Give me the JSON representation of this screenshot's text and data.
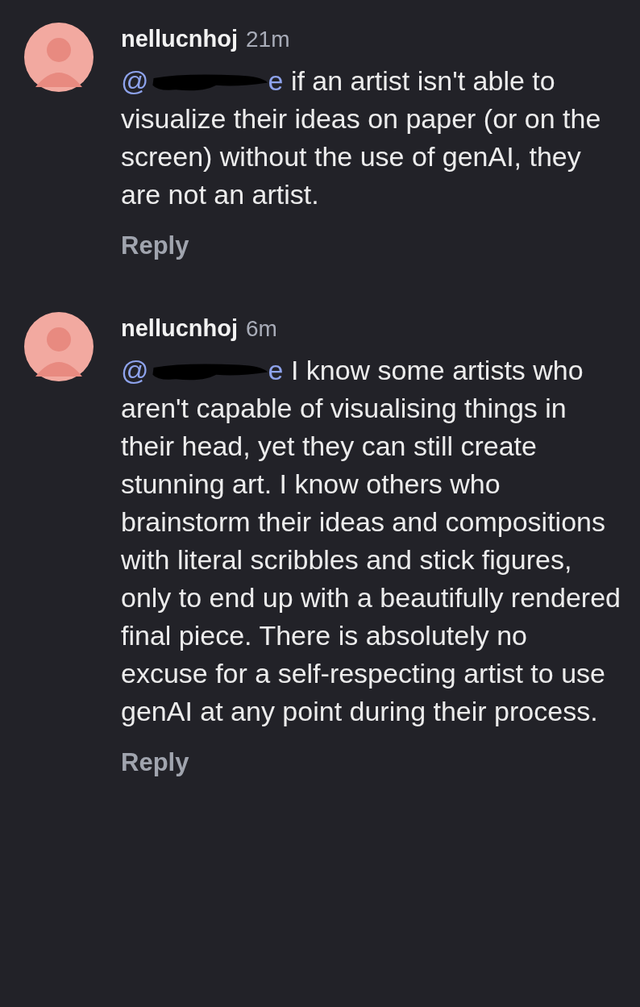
{
  "comments": [
    {
      "author": "nellucnhoj",
      "time": "21m",
      "mention_start": "@",
      "mention_end": "e",
      "text": "if an artist isn't able to visualize their ideas on paper (or on the screen) without the use of genAI, they are not an artist.",
      "reply": "Reply"
    },
    {
      "author": "nellucnhoj",
      "time": "6m",
      "mention_start": "@",
      "mention_end": "e",
      "text": "I know some artists who aren't capable of visualising things in their head, yet they can still create stunning art. I know others who brainstorm their ideas and compositions with literal scribbles and stick figures, only to end up with a beautifully rendered final piece. There is absolutely no excuse for a self-respecting artist to use genAI at any point during their process.",
      "reply": "Reply"
    }
  ]
}
